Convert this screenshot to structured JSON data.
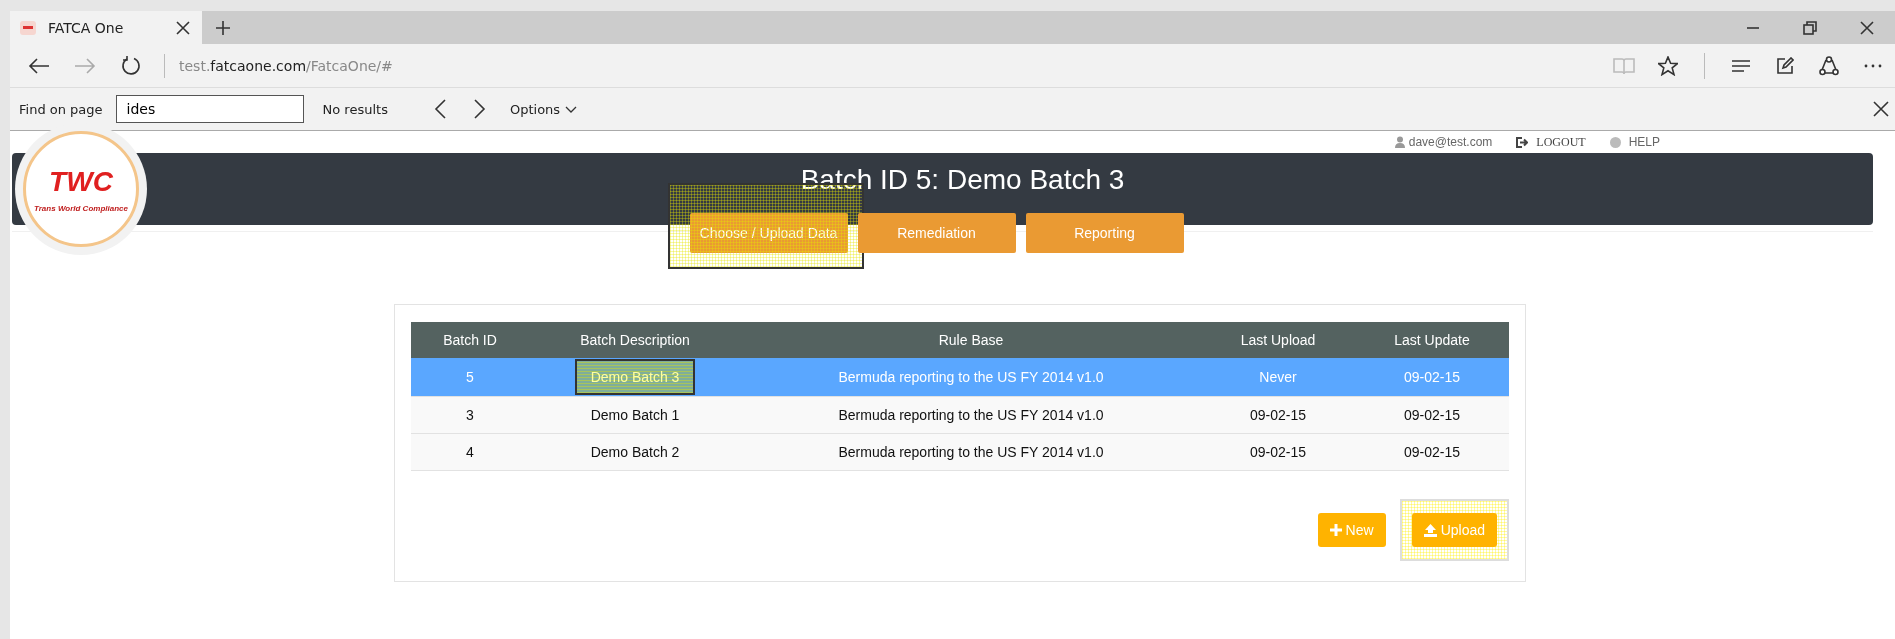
{
  "browser": {
    "tab": {
      "title": "FATCA One"
    },
    "address": {
      "prefix": "test.",
      "domain": "fatcaone.com",
      "path": "/FatcaOne/#"
    }
  },
  "find_bar": {
    "label": "Find on page",
    "query": "ides",
    "result": "No results",
    "options": "Options"
  },
  "user_bar": {
    "user": "dave@test.com",
    "logout": "LOGOUT",
    "help": "HELP"
  },
  "header": {
    "logo_text": "TWC",
    "logo_tagline": "Trans World Compliance",
    "title": "Batch ID 5: Demo Batch 3"
  },
  "nav": [
    {
      "label": "Choose / Upload Data",
      "highlighted": true
    },
    {
      "label": "Remediation",
      "highlighted": false
    },
    {
      "label": "Reporting",
      "highlighted": false
    }
  ],
  "table": {
    "columns": [
      "Batch ID",
      "Batch Description",
      "Rule Base",
      "Last Upload",
      "Last Update"
    ],
    "rows": [
      {
        "selected": true,
        "cells": [
          {
            "text": "5",
            "highlighted": false
          },
          {
            "text": "Demo Batch 3",
            "highlighted": true
          },
          {
            "text": "Bermuda reporting to the US FY 2014 v1.0",
            "highlighted": false
          },
          {
            "text": "Never",
            "highlighted": false
          },
          {
            "text": "09-02-15",
            "highlighted": false
          }
        ]
      },
      {
        "selected": false,
        "cells": [
          {
            "text": "3",
            "highlighted": false
          },
          {
            "text": "Demo Batch 1",
            "highlighted": false
          },
          {
            "text": "Bermuda reporting to the US FY 2014 v1.0",
            "highlighted": false
          },
          {
            "text": "09-02-15",
            "highlighted": false
          },
          {
            "text": "09-02-15",
            "highlighted": false
          }
        ]
      },
      {
        "selected": false,
        "cells": [
          {
            "text": "4",
            "highlighted": false
          },
          {
            "text": "Demo Batch 2",
            "highlighted": false
          },
          {
            "text": "Bermuda reporting to the US FY 2014 v1.0",
            "highlighted": false
          },
          {
            "text": "09-02-15",
            "highlighted": false
          },
          {
            "text": "09-02-15",
            "highlighted": false
          }
        ]
      }
    ]
  },
  "actions": [
    {
      "kind": "new",
      "label": "New",
      "highlighted": false
    },
    {
      "kind": "upload",
      "label": "Upload",
      "highlighted": true
    }
  ]
}
